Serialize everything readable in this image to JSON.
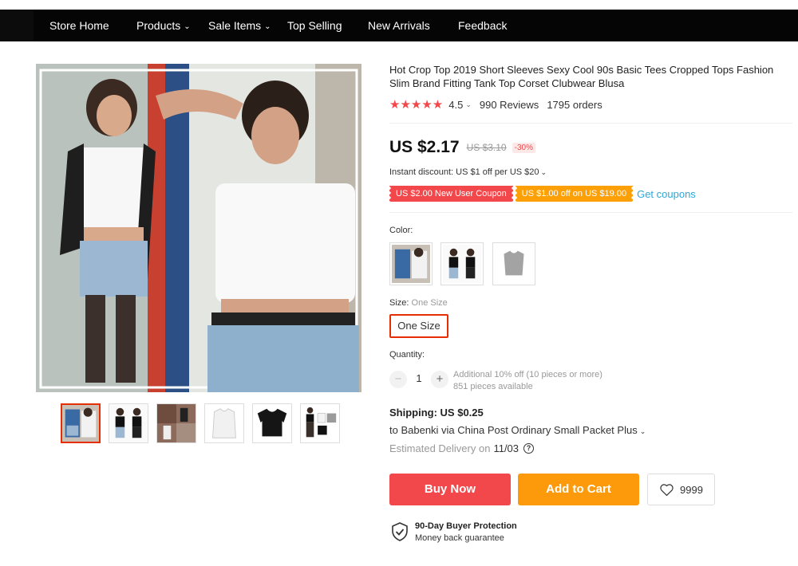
{
  "nav": {
    "items": [
      {
        "label": "Store Home",
        "has_dropdown": false
      },
      {
        "label": "Products",
        "has_dropdown": true
      },
      {
        "label": "Sale Items",
        "has_dropdown": true
      },
      {
        "label": "Top Selling",
        "has_dropdown": false
      },
      {
        "label": "New Arrivals",
        "has_dropdown": false
      },
      {
        "label": "Feedback",
        "has_dropdown": false
      }
    ]
  },
  "product": {
    "title": "Hot Crop Top 2019 Short Sleeves Sexy Cool 90s Basic Tees Cropped Tops Fashion Slim Brand Fitting Tank Top Corset Clubwear Blusa",
    "rating": {
      "stars": "★★★★★",
      "value": "4.5",
      "reviews": "990 Reviews",
      "orders": "1795 orders"
    },
    "price": {
      "current": "US $2.17",
      "original": "US $3.10",
      "discount": "-30%"
    },
    "instant_discount": "Instant discount: US $1 off per US $20",
    "coupons": [
      {
        "label": "US $2.00 New User Coupon",
        "color": "#f2484b"
      },
      {
        "label": "US $1.00 off on US $19.00",
        "color": "#fda007"
      }
    ],
    "get_coupons_label": "Get coupons",
    "color": {
      "label": "Color:",
      "options": [
        "white-tee-photo",
        "black-tee-photo",
        "gray-tee-photo"
      ]
    },
    "size": {
      "label": "Size:",
      "selected_label": "One Size",
      "options": [
        "One Size"
      ]
    },
    "quantity": {
      "label": "Quantity:",
      "value": "1",
      "minus": "−",
      "plus": "+",
      "offer": "Additional 10% off (10 pieces or more)",
      "available": "851 pieces available"
    },
    "shipping": {
      "title": "Shipping: US $0.25",
      "via": "to Babenki via China Post Ordinary Small Packet Plus",
      "delivery_label": "Estimated Delivery on",
      "delivery_date": "11/03",
      "help_icon": "?"
    },
    "actions": {
      "buy_now": "Buy Now",
      "add_to_cart": "Add to Cart",
      "wishlist_count": "9999"
    },
    "protection": {
      "title": "90-Day Buyer Protection",
      "subtitle": "Money back guarantee"
    },
    "thumbnails": [
      "thumb-collage",
      "thumb-black-white-models",
      "thumb-street-collage",
      "thumb-white-tee",
      "thumb-black-tee",
      "thumb-three-colors"
    ]
  },
  "colors": {
    "accent_red": "#f2484b",
    "accent_orange": "#fd9a0b",
    "link_blue": "#2ea8d6",
    "nav_bg": "#050505",
    "selected_border": "#e62e04"
  }
}
